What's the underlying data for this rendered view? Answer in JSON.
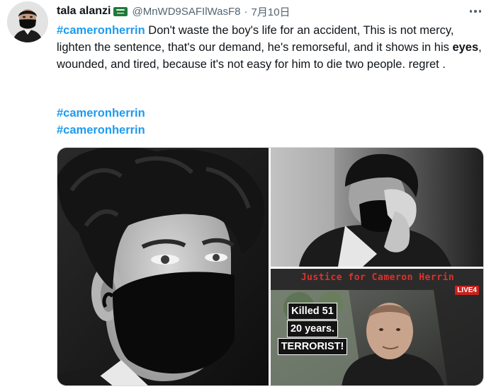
{
  "tweet": {
    "author": {
      "display_name": "tala alanzi",
      "flag_icon": "saudi-flag-icon",
      "handle": "@MnWD9SAFIlWasF8",
      "separator": "·",
      "date": "7月10日"
    },
    "more_icon": "more-horizontal-icon",
    "text": {
      "hashtag": "#cameronherrin",
      "part1": " Don't waste the boy's life for an accident, This is not mercy, lighten the sentence, that's our demand, he's remorseful, and it shows in his ",
      "bold_word": "eyes",
      "part2": ", wounded, and tired, because it's not easy for him to die two people. regret ."
    },
    "hashtags": [
      "#cameronherrin",
      "#cameronherrin"
    ],
    "media": {
      "photos": [
        {
          "name": "masked-young-man-closeup-photo"
        },
        {
          "name": "man-wiping-eyes-photo"
        },
        {
          "name": "news-screenshot-photo",
          "overlay_title": "Justice for Cameron Herrin",
          "live_badge": "LIVE4",
          "verdict_lines": [
            "Killed 51",
            "20 years.",
            "TERRORIST!"
          ]
        }
      ]
    }
  },
  "colors": {
    "link": "#1d9bf0",
    "text": "#0f1419",
    "secondary": "#536471",
    "news_red": "#e0302b"
  }
}
